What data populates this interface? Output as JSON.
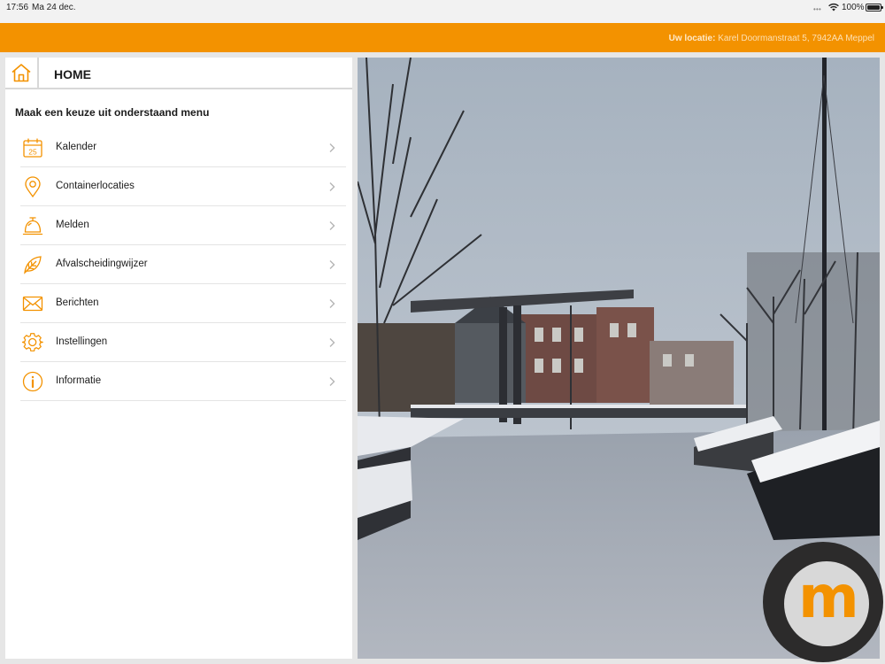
{
  "status_bar": {
    "time": "17:56",
    "date": "Ma 24 dec.",
    "battery": "100%"
  },
  "header": {
    "location_label": "Uw locatie:",
    "location_value": "Karel Doormanstraat 5, 7942AA Meppel",
    "accent_color": "#f39200"
  },
  "panel": {
    "title": "HOME",
    "home_icon": "home-icon",
    "intro": "Maak een keuze uit onderstaand menu"
  },
  "menu": [
    {
      "label": "Kalender",
      "icon": "calendar-icon",
      "icon_text": "25"
    },
    {
      "label": "Containerlocaties",
      "icon": "location-pin-icon"
    },
    {
      "label": "Melden",
      "icon": "service-bell-icon"
    },
    {
      "label": "Afvalscheidingwijzer",
      "icon": "leaf-icon"
    },
    {
      "label": "Berichten",
      "icon": "envelope-icon"
    },
    {
      "label": "Instellingen",
      "icon": "gear-icon"
    },
    {
      "label": "Informatie",
      "icon": "info-icon"
    }
  ],
  "logo": {
    "letter": "m"
  }
}
